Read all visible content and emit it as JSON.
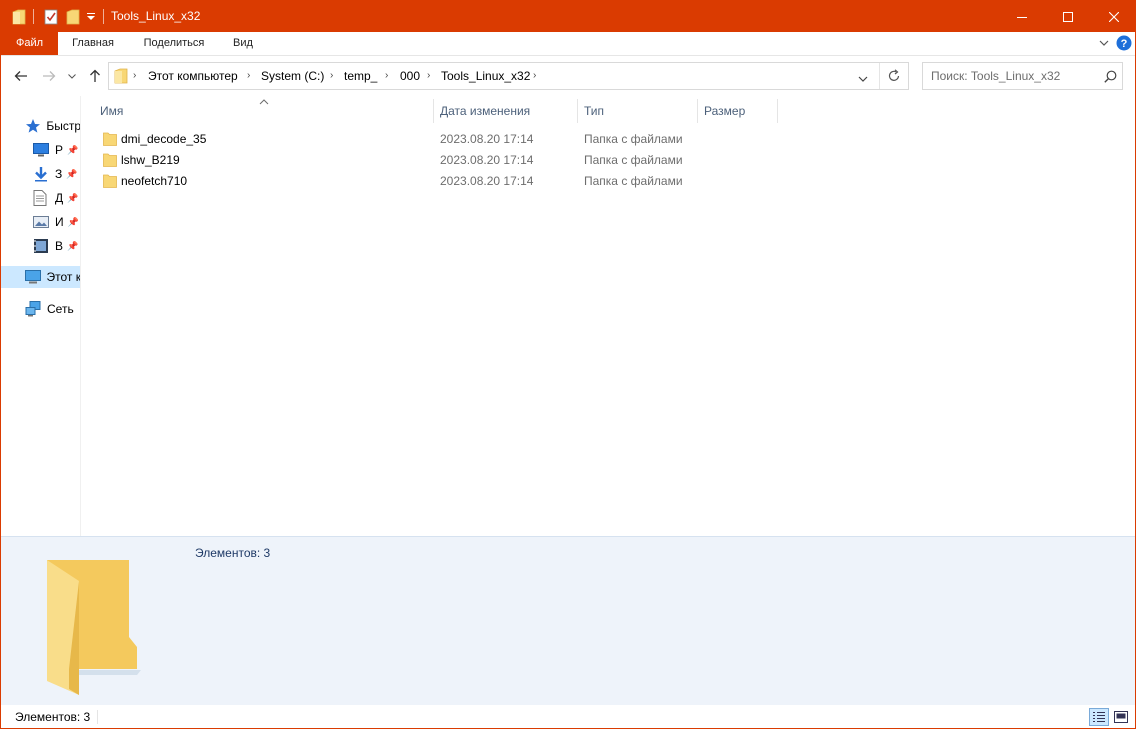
{
  "window": {
    "title": "Tools_Linux_x32",
    "accent_color": "#da3b01",
    "controls": [
      "minimize-icon",
      "maximize-icon",
      "close-icon"
    ]
  },
  "quick_access": {
    "icons": [
      "folder-icon",
      "properties-icon",
      "new-folder-icon",
      "customize-dropdown-icon"
    ]
  },
  "ribbon": {
    "tabs": [
      {
        "label": "Файл"
      },
      {
        "label": "Главная"
      },
      {
        "label": "Поделиться"
      },
      {
        "label": "Вид"
      }
    ],
    "right_icons": [
      "expand-ribbon-icon",
      "help-icon"
    ]
  },
  "navigation": {
    "buttons": [
      "back-arrow-icon",
      "forward-arrow-icon",
      "recent-dropdown-icon",
      "up-arrow-icon"
    ],
    "breadcrumb": [
      "Этот компьютер",
      "System (C:)",
      "temp_",
      "000",
      "Tools_Linux_x32"
    ],
    "search_placeholder": "Поиск: Tools_Linux_x32"
  },
  "nav_pane": {
    "items": [
      {
        "label": "Быстр",
        "icon": "star-icon",
        "pinned": false
      },
      {
        "label": "Р",
        "icon": "desktop-icon",
        "pinned": true
      },
      {
        "label": "З",
        "icon": "download-icon",
        "pinned": true
      },
      {
        "label": "Д",
        "icon": "document-icon",
        "pinned": true
      },
      {
        "label": "И",
        "icon": "image-icon",
        "pinned": true
      },
      {
        "label": "В",
        "icon": "video-icon",
        "pinned": true
      },
      {
        "label": "Этот к",
        "icon": "computer-icon",
        "pinned": false,
        "selected": true
      },
      {
        "label": "Сеть",
        "icon": "network-icon",
        "pinned": false
      }
    ]
  },
  "file_list": {
    "columns": [
      {
        "label": "Имя",
        "sorted": "ascending"
      },
      {
        "label": "Дата изменения"
      },
      {
        "label": "Тип"
      },
      {
        "label": "Размер"
      }
    ],
    "rows": [
      {
        "name": "dmi_decode_35",
        "date": "2023.08.20 17:14",
        "type": "Папка с файлами",
        "size": ""
      },
      {
        "name": "lshw_B219",
        "date": "2023.08.20 17:14",
        "type": "Папка с файлами",
        "size": ""
      },
      {
        "name": "neofetch710",
        "date": "2023.08.20 17:14",
        "type": "Папка с файлами",
        "size": ""
      }
    ]
  },
  "details_pane": {
    "text": "Элементов: 3",
    "icon": "large-folder-icon"
  },
  "status_bar": {
    "text": "Элементов: 3",
    "view_buttons": [
      "details-view-icon",
      "large-icons-view-icon"
    ]
  }
}
